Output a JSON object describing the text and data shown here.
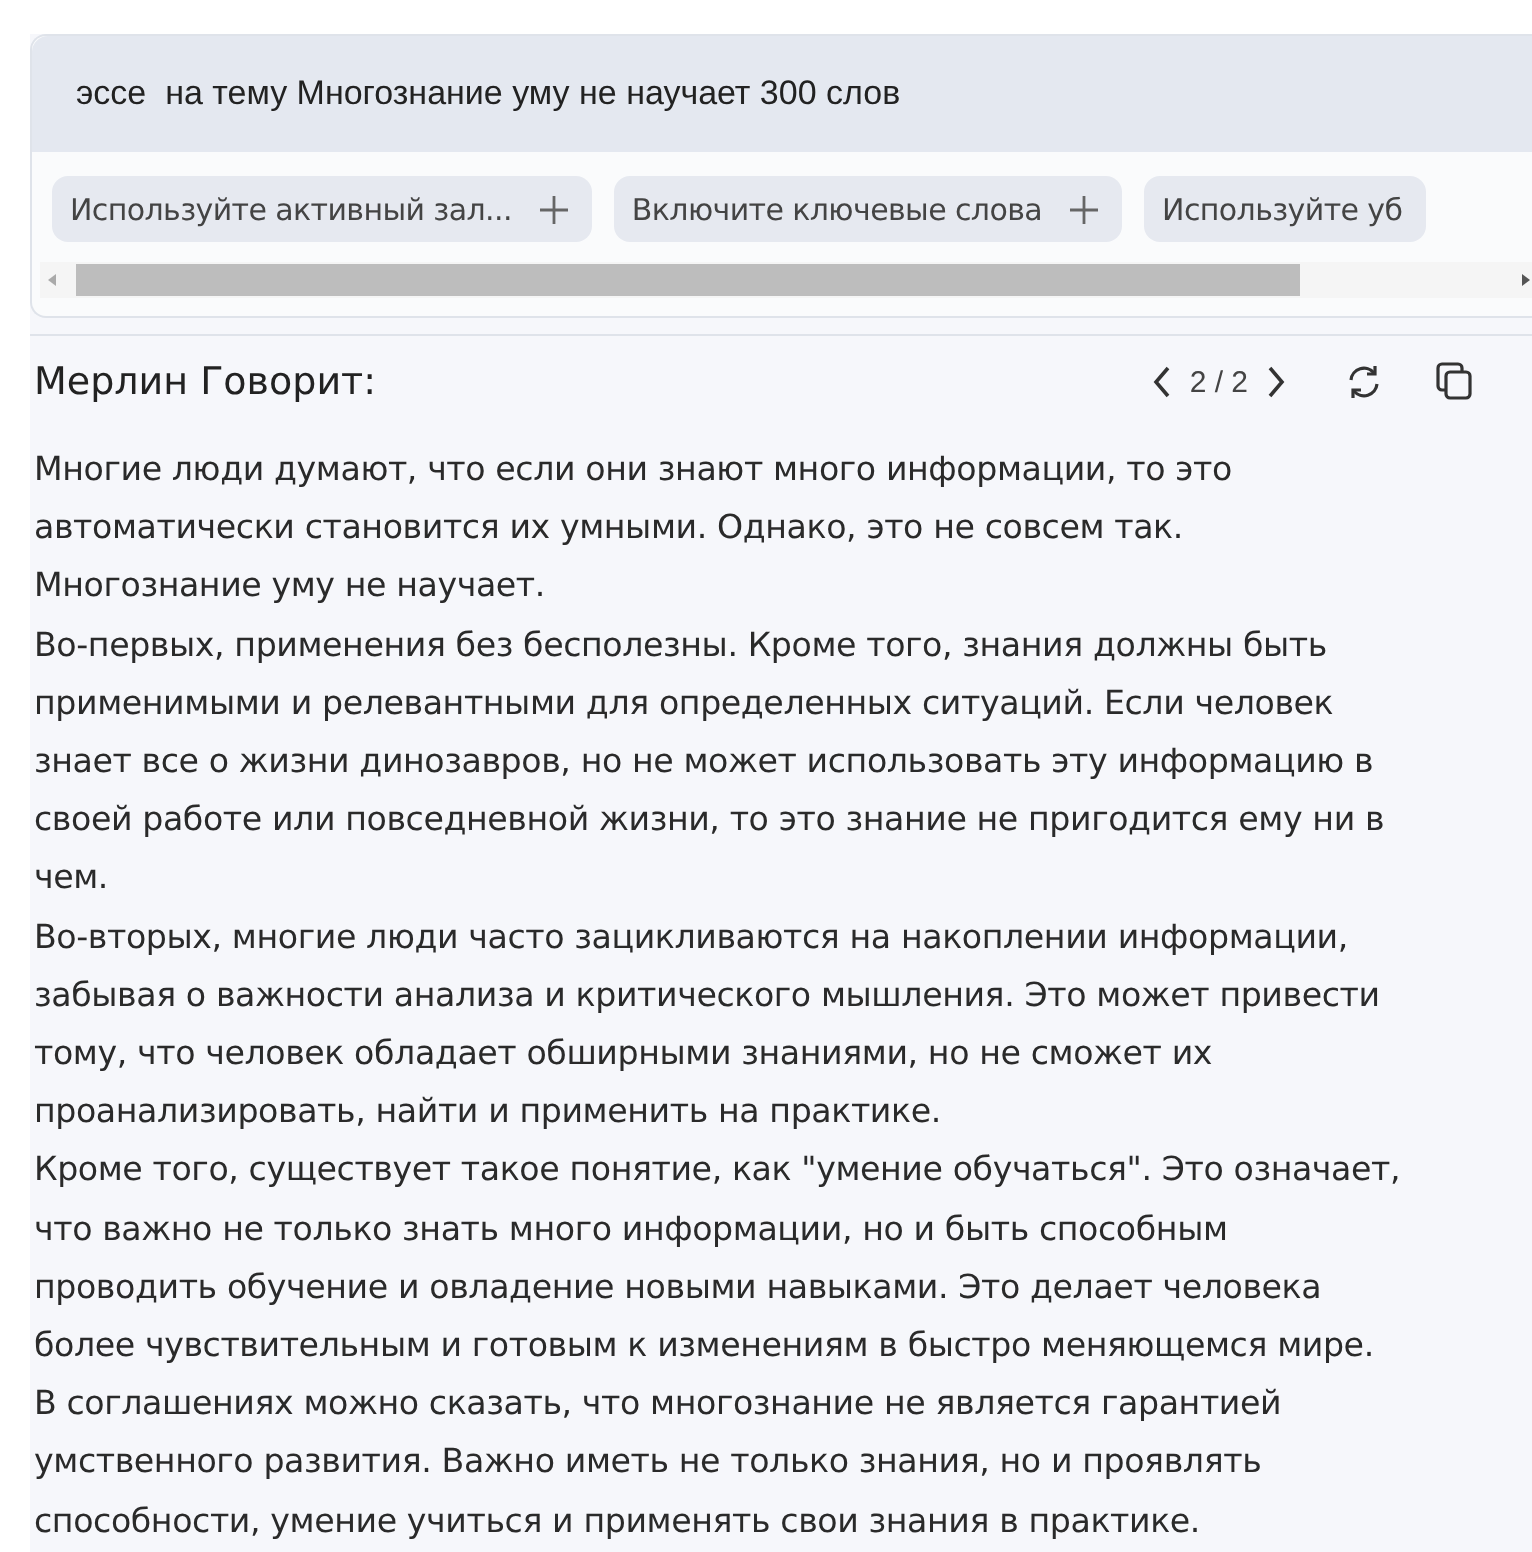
{
  "prompt": {
    "value": "эссе  на тему Многознание уму не научает 300 слов"
  },
  "suggestions": [
    {
      "label": "Используйте активный зал...",
      "plus": true
    },
    {
      "label": "Включите ключевые слова",
      "plus": true
    },
    {
      "label": "Используйте уб",
      "plus": false
    }
  ],
  "response": {
    "title": "Мерлин Говорит:",
    "page": "2 / 2",
    "lines": [
      "Многие люди думают, что если они знают много информации, то это",
      "автоматически становится их умными. Однако, это не совсем так.",
      "Многознание уму не научает.",
      "Во-первых, применения без бесполезны. Кроме того, знания должны быть",
      "применимыми и релевантными для определенных ситуаций. Если человек",
      "знает все о жизни динозавров, но не может использовать эту информацию в",
      "своей работе или повседневной жизни, то это знание не пригодится ему ни в",
      "чем.",
      "Во-вторых, многие люди часто зацикливаются на накоплении информации,",
      "забывая о важности анализа и критического мышления. Это может привести",
      "тому, что человек обладает обширными знаниями, но не сможет их",
      "проанализировать, найти и применить на практике.",
      "Кроме того, существует такое понятие, как \"умение обучаться\". Это означает,",
      "что важно не только знать много информации, но и быть способным",
      "проводить обучение и овладение новыми навыками. Это делает человека",
      "более чувствительным и готовым к изменениям в быстро меняющемся мире.",
      "В соглашениях можно сказать, что многознание не является гарантией",
      "умственного развития. Важно иметь не только знания, но и проявлять",
      "способности, умение учиться и применять свои знания в практике."
    ]
  }
}
